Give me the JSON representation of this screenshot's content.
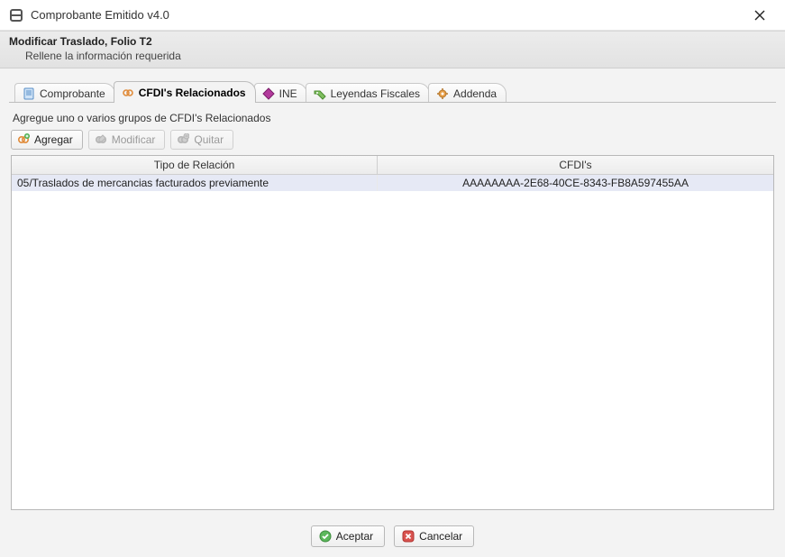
{
  "window": {
    "title": "Comprobante Emitido v4.0"
  },
  "header": {
    "title": "Modificar Traslado, Folio T2",
    "subtitle": "Rellene la información requerida"
  },
  "tabs": [
    {
      "id": "comprobante",
      "label": "Comprobante",
      "icon": "document-icon",
      "active": false
    },
    {
      "id": "cfdis",
      "label": "CFDI's Relacionados",
      "icon": "link-icon",
      "active": true
    },
    {
      "id": "ine",
      "label": "INE",
      "icon": "diamond-icon",
      "active": false
    },
    {
      "id": "leyendas",
      "label": "Leyendas Fiscales",
      "icon": "tag-icon",
      "active": false
    },
    {
      "id": "addenda",
      "label": "Addenda",
      "icon": "gear-icon",
      "active": false
    }
  ],
  "panel": {
    "instruction": "Agregue uno o varios grupos de CFDI's Relacionados",
    "toolbar": {
      "add_label": "Agregar",
      "edit_label": "Modificar",
      "remove_label": "Quitar"
    },
    "table": {
      "headers": {
        "relation": "Tipo de Relación",
        "cfdis": "CFDI's"
      },
      "rows": [
        {
          "relation": "05/Traslados de mercancias facturados previamente",
          "cfdis": "AAAAAAAA-2E68-40CE-8343-FB8A597455AA"
        }
      ]
    }
  },
  "footer": {
    "accept_label": "Aceptar",
    "cancel_label": "Cancelar"
  }
}
